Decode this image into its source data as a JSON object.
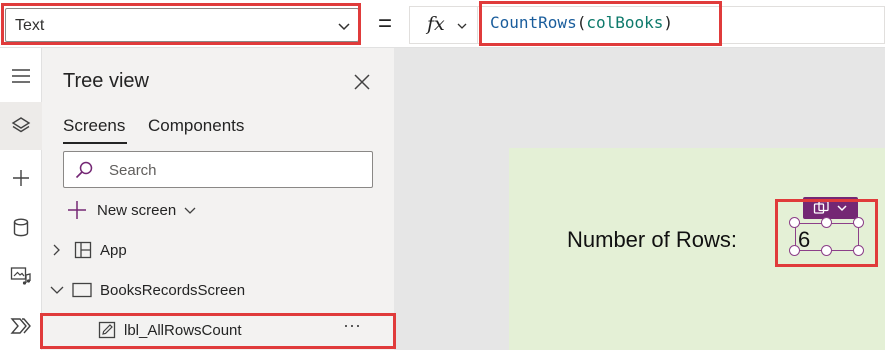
{
  "formula_bar": {
    "property_value": "Text",
    "equals": "=",
    "fx_label": "fx",
    "formula": {
      "function": "CountRows",
      "open_paren": "(",
      "argument": "colBooks",
      "close_paren": ")"
    }
  },
  "tree_view": {
    "title": "Tree view",
    "tabs": [
      {
        "label": "Screens",
        "active": true
      },
      {
        "label": "Components",
        "active": false
      }
    ],
    "search_placeholder": "Search",
    "new_screen_label": "New screen",
    "nodes": [
      {
        "label": "App",
        "icon": "app-grid-icon",
        "expanded": false
      },
      {
        "label": "BooksRecordsScreen",
        "icon": "screen-icon",
        "expanded": true
      },
      {
        "label": "lbl_AllRowsCount",
        "icon": "label-edit-icon",
        "selected": true,
        "more": "···"
      }
    ]
  },
  "canvas": {
    "label_text": "Number of Rows:",
    "selected_value": "6"
  },
  "colors": {
    "highlight": "#e03b3b",
    "selection": "#8c3f89",
    "chip": "#742774",
    "screen_bg": "#e4f0d6"
  }
}
